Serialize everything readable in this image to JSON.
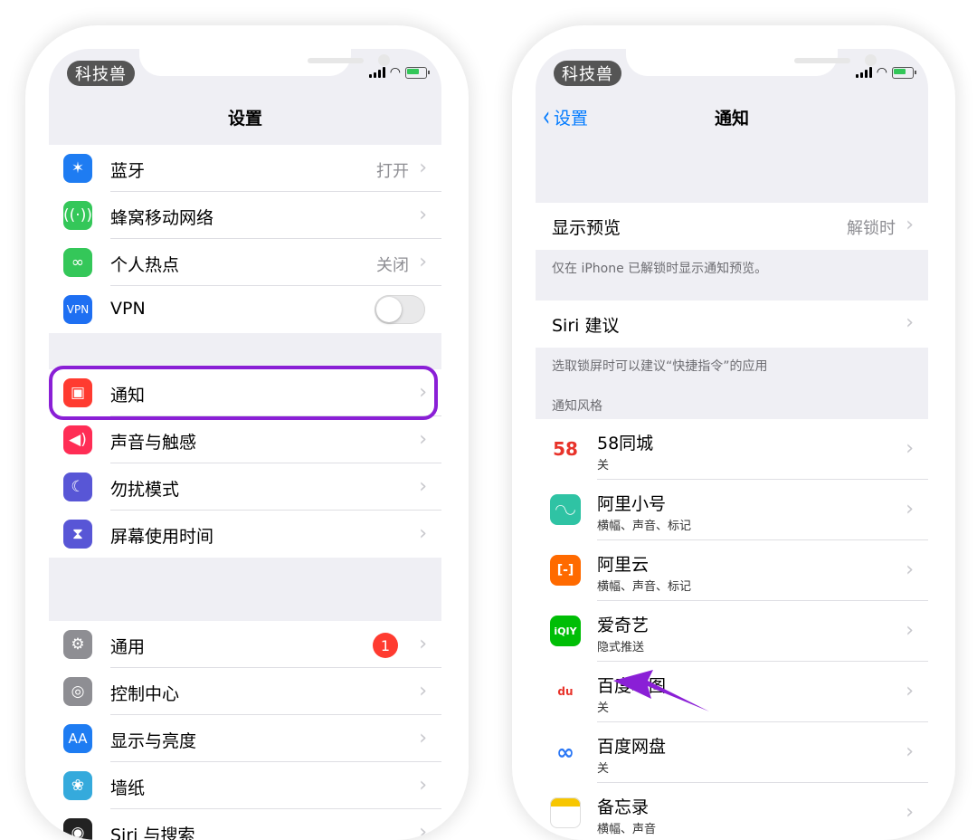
{
  "left": {
    "carrier": "科技兽",
    "nav_title": "设置",
    "group1": [
      {
        "label": "蓝牙",
        "value": "打开",
        "icon": "bluetooth-icon",
        "color": "#1e7cf2"
      },
      {
        "label": "蜂窝移动网络",
        "value": "",
        "icon": "antenna-icon",
        "color": "#34c759"
      },
      {
        "label": "个人热点",
        "value": "关闭",
        "icon": "hotspot-icon",
        "color": "#34c759"
      },
      {
        "label": "VPN",
        "value": "",
        "icon": "vpn-icon",
        "color": "#1e6ff2"
      }
    ],
    "group2": [
      {
        "label": "通知",
        "icon": "notification-icon",
        "color": "#ff3b30"
      },
      {
        "label": "声音与触感",
        "icon": "speaker-icon",
        "color": "#ff2d55"
      },
      {
        "label": "勿扰模式",
        "icon": "moon-icon",
        "color": "#5856d6"
      },
      {
        "label": "屏幕使用时间",
        "icon": "hourglass-icon",
        "color": "#5856d6"
      }
    ],
    "group3": [
      {
        "label": "通用",
        "badge": "1",
        "icon": "gear-icon",
        "color": "#8e8e93"
      },
      {
        "label": "控制中心",
        "icon": "switches-icon",
        "color": "#8e8e93"
      },
      {
        "label": "显示与亮度",
        "icon": "text-size-icon",
        "color": "#1e7cf2"
      },
      {
        "label": "墙纸",
        "icon": "flower-icon",
        "color": "#35aadc"
      },
      {
        "label": "Siri 与搜索",
        "icon": "siri-icon",
        "color": "#222222"
      }
    ],
    "vpn_icon_text": "VPN",
    "display_icon_text": "AA"
  },
  "right": {
    "carrier": "科技兽",
    "back_label": "设置",
    "nav_title": "通知",
    "preview_label": "显示预览",
    "preview_value": "解锁时",
    "preview_caption": "仅在 iPhone 已解锁时显示通知预览。",
    "siri_label": "Siri 建议",
    "siri_caption": "选取锁屏时可以建议“快捷指令”的应用",
    "style_header": "通知风格",
    "apps": [
      {
        "name": "58同城",
        "sub": "关",
        "icon_text": "58",
        "icon": "58-app-icon",
        "color": "#ffffff"
      },
      {
        "name": "阿里小号",
        "sub": "横幅、声音、标记",
        "icon_text": "◠◡",
        "icon": "alixiaohao-app-icon",
        "color": "#2fc3a4"
      },
      {
        "name": "阿里云",
        "sub": "横幅、声音、标记",
        "icon_text": "[-]",
        "icon": "aliyun-app-icon",
        "color": "#ff6a00"
      },
      {
        "name": "爱奇艺",
        "sub": "隐式推送",
        "icon_text": "iQIY",
        "icon": "iqiyi-app-icon",
        "color": "#00be06"
      },
      {
        "name": "百度地图",
        "sub": "关",
        "icon_text": "du",
        "icon": "baidu-map-app-icon",
        "color": "#ffffff"
      },
      {
        "name": "百度网盘",
        "sub": "关",
        "icon_text": "∞",
        "icon": "baidu-pan-app-icon",
        "color": "#ffffff"
      },
      {
        "name": "备忘录",
        "sub": "横幅、声音",
        "icon_text": "",
        "icon": "notes-app-icon",
        "color": "#ffffff"
      }
    ]
  },
  "highlight_color": "#8a1fd6"
}
